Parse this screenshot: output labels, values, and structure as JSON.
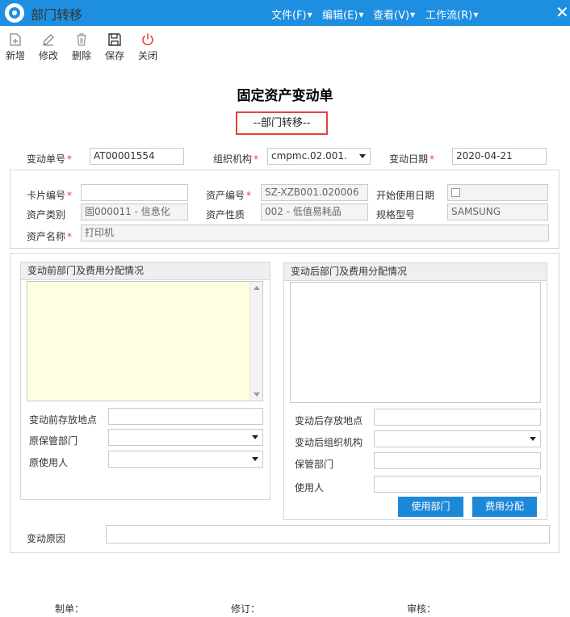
{
  "window": {
    "title": "部门转移",
    "menus": [
      "文件(F)",
      "编辑(E)",
      "查看(V)",
      "工作流(R)"
    ],
    "close_glyph": "✕"
  },
  "toolbar": {
    "new": "新增",
    "edit": "修改",
    "delete": "删除",
    "save": "保存",
    "close": "关闭"
  },
  "document": {
    "title": "固定资产变动单",
    "subtitle": "--部门转移--"
  },
  "header_fields": {
    "change_no_label": "变动单号",
    "change_no_value": "AT00001554",
    "org_label": "组织机构",
    "org_value": "cmpmc.02.001.",
    "change_date_label": "变动日期",
    "change_date_value": "2020-04-21"
  },
  "asset_fields": {
    "card_no_label": "卡片编号",
    "card_no_value": "",
    "asset_no_label": "资产编号",
    "asset_no_value": "SZ-XZB001.020006",
    "start_date_label": "开始使用日期",
    "category_label": "资产类别",
    "category_value": "固000011 - 信息化",
    "nature_label": "资产性质",
    "nature_value": "002 - 低值易耗品",
    "model_label": "规格型号",
    "model_value": "SAMSUNG",
    "name_label": "资产名称",
    "name_value": "打印机"
  },
  "before_panel": {
    "title": "变动前部门及费用分配情况",
    "location_label": "变动前存放地点",
    "location_value": "",
    "orig_dept_label": "原保管部门",
    "orig_dept_value": "",
    "orig_user_label": "原使用人",
    "orig_user_value": ""
  },
  "after_panel": {
    "title": "变动后部门及费用分配情况",
    "location_label": "变动后存放地点",
    "location_value": "",
    "org_label": "变动后组织机构",
    "org_value": "",
    "dept_label": "保管部门",
    "dept_value": "",
    "user_label": "使用人",
    "user_value": "",
    "use_dept_button": "使用部门",
    "cost_alloc_button": "费用分配"
  },
  "reason": {
    "label": "变动原因",
    "value": ""
  },
  "footer": {
    "maker": "制单：",
    "revise": "修订：",
    "audit": "审核："
  },
  "colors": {
    "titlebar": "#1e8fe0",
    "button": "#1e88d8",
    "required": "#e8413b",
    "highlight_area": "#fefee0"
  }
}
